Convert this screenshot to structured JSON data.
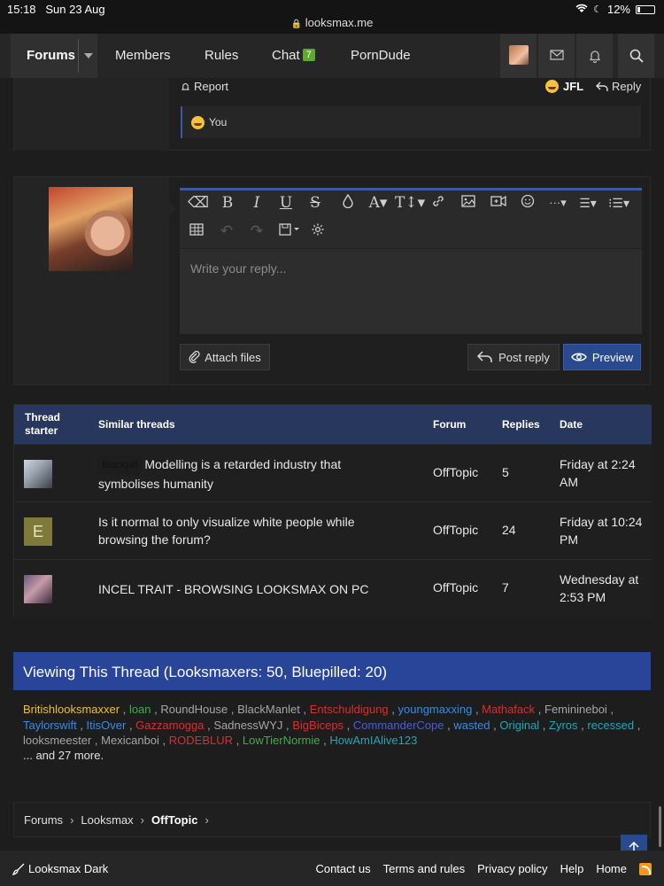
{
  "status": {
    "time": "15:18",
    "date": "Sun 23 Aug",
    "battery": "12%"
  },
  "url": "looksmax.me",
  "nav": {
    "forums": "Forums",
    "members": "Members",
    "rules": "Rules",
    "chat": "Chat",
    "chat_badge": "7",
    "porndude": "PornDude"
  },
  "message": {
    "report": "Report",
    "reaction_label": "JFL",
    "reply": "Reply",
    "reacted_by": "You"
  },
  "editor": {
    "placeholder": "Write your reply...",
    "attach_files": "Attach files",
    "post_reply": "Post reply",
    "preview": "Preview"
  },
  "similar_threads": {
    "headers": {
      "starter": "Thread starter",
      "title": "Similar threads",
      "forum": "Forum",
      "replies": "Replies",
      "date": "Date"
    },
    "rows": [
      {
        "prefix": "Blackpill",
        "title": "Modelling is a retarded industry that symbolises humanity",
        "forum": "OffTopic",
        "replies": "5",
        "date": "Friday at 2:24 AM"
      },
      {
        "avatar_letter": "E",
        "title": "Is it normal to only visualize white people while browsing the forum?",
        "forum": "OffTopic",
        "replies": "24",
        "date": "Friday at 10:24 PM"
      },
      {
        "title": "INCEL TRAIT - BROWSING LOOKSMAX ON PC",
        "forum": "OffTopic",
        "replies": "7",
        "date": "Wednesday at 2:53 PM"
      }
    ]
  },
  "viewing": {
    "title": "Viewing This Thread (Looksmaxers: 50, Bluepilled: 20)",
    "users": [
      {
        "name": "Britishlooksmaxxer",
        "color": "#e8c238"
      },
      {
        "name": "loan",
        "color": "#3fae4a"
      },
      {
        "name": "RoundHouse",
        "color": "#a6a6a6"
      },
      {
        "name": "BlackManlet",
        "color": "#a6a6a6"
      },
      {
        "name": "Entschuldigung",
        "color": "#d63030"
      },
      {
        "name": "youngmaxxing",
        "color": "#3a8be0"
      },
      {
        "name": "Mathafack",
        "color": "#d63030"
      },
      {
        "name": "Feminineboi",
        "color": "#a6a6a6"
      },
      {
        "name": "Taylorswift",
        "color": "#3a8be0"
      },
      {
        "name": "ItisOver",
        "color": "#3a8be0"
      },
      {
        "name": "Gazzamogga",
        "color": "#d63030"
      },
      {
        "name": "SadnessWYJ",
        "color": "#a6a6a6"
      },
      {
        "name": "BigBiceps",
        "color": "#d63030"
      },
      {
        "name": "CommanderCope",
        "color": "#4a5fd0"
      },
      {
        "name": "wasted",
        "color": "#3a8be0"
      },
      {
        "name": "Original",
        "color": "#21a6b8"
      },
      {
        "name": "Zyros",
        "color": "#21a6b8"
      },
      {
        "name": "recessed",
        "color": "#21a6b8"
      },
      {
        "name": "looksmeester",
        "color": "#a6a6a6"
      },
      {
        "name": "Mexicanboi",
        "color": "#a6a6a6"
      },
      {
        "name": "RODEBLUR",
        "color": "#d63030"
      },
      {
        "name": "LowTierNormie",
        "color": "#3fae4a"
      },
      {
        "name": "HowAmIAlive123",
        "color": "#21a6b8"
      }
    ],
    "more": "... and 27 more."
  },
  "breadcrumb": {
    "items": [
      "Forums",
      "Looksmax",
      "OffTopic"
    ]
  },
  "footer": {
    "theme": "Looksmax Dark",
    "links": [
      "Contact us",
      "Terms and rules",
      "Privacy policy",
      "Help",
      "Home"
    ]
  }
}
